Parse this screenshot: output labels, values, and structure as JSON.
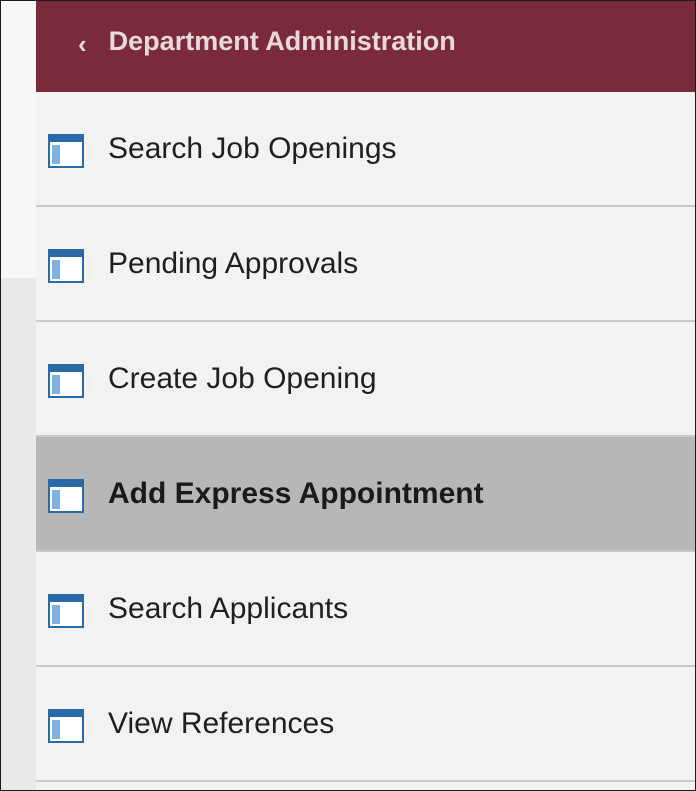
{
  "header": {
    "back_glyph": "‹",
    "title": "Department Administration",
    "color": "#7b2a3b"
  },
  "menu": {
    "items": [
      {
        "label": "Search Job Openings",
        "icon": "page-icon",
        "active": false
      },
      {
        "label": "Pending Approvals",
        "icon": "page-icon",
        "active": false
      },
      {
        "label": "Create Job Opening",
        "icon": "page-icon",
        "active": false
      },
      {
        "label": "Add Express Appointment",
        "icon": "page-icon",
        "active": true
      },
      {
        "label": "Search Applicants",
        "icon": "page-icon",
        "active": false
      },
      {
        "label": "View References",
        "icon": "page-icon",
        "active": false
      }
    ]
  }
}
